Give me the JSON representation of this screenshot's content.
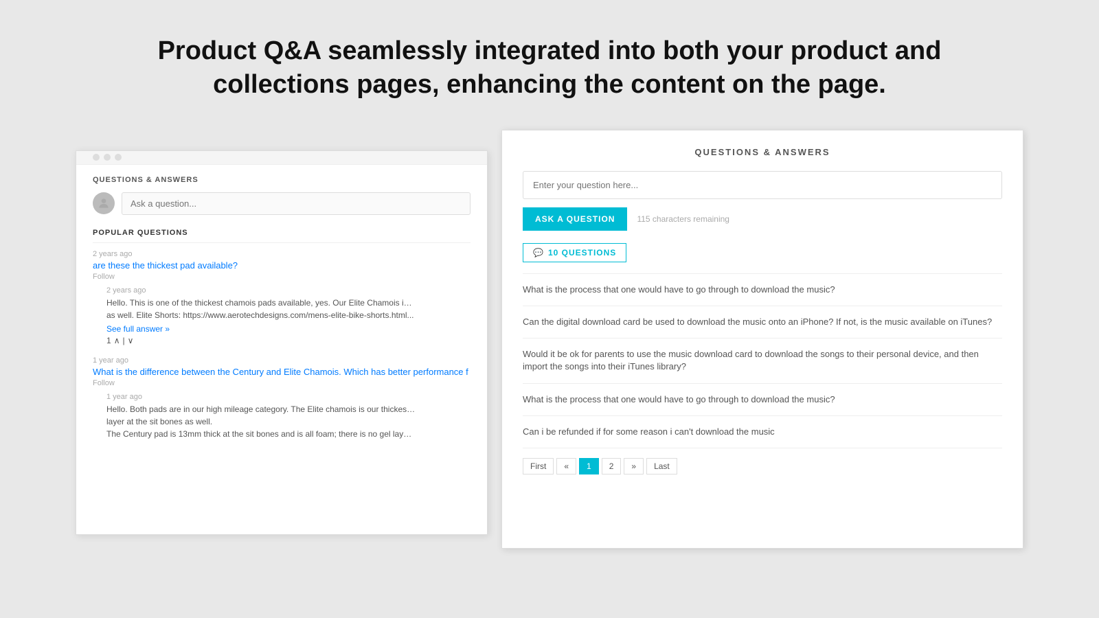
{
  "headline": {
    "line1": "Product Q&A seamlessly integrated into both your  product and",
    "line2": "collections pages, enhancing the content on the page."
  },
  "left_panel": {
    "section_title": "QUESTIONS & ANSWERS",
    "ask_placeholder": "Ask a question...",
    "popular_title": "POPULAR QUESTIONS",
    "questions": [
      {
        "meta": "2 years ago",
        "text": "are these the thickest pad available?",
        "follow": "Follow",
        "answer": {
          "meta": "2 years ago",
          "text": "Hello. This is one of the thickest chamois pads available, yes. Our Elite Chamois is a little b",
          "text2": "as well. Elite Shorts: https://www.aerotechdesigns.com/mens-elite-bike-shorts.html...",
          "see_full": "See full answer »",
          "votes": "1"
        }
      },
      {
        "meta": "1 year ago",
        "text": "What is the difference between the Century and Elite Chamois. Which has better performance f",
        "follow": "Follow",
        "answer": {
          "meta": "1 year ago",
          "text": "Hello. Both pads are in our high mileage category. The Elite chamois is our thickest pad in",
          "text2": "layer at the sit bones as well.",
          "see_full": "",
          "text3": "The Century pad is 13mm thick at the sit bones and is all foam; there is no gel layer like in"
        }
      }
    ]
  },
  "right_panel": {
    "title": "QUESTIONS & ANSWERS",
    "question_placeholder": "Enter your question here...",
    "ask_btn_label": "ASK A QUESTION",
    "chars_remaining": "115 characters remaining",
    "questions_tab_label": "10 QUESTIONS",
    "questions": [
      "What is the process that one would have to go through to download the music?",
      "Can the digital download card be used to download the music onto an iPhone? If not, is the music available on iTunes?",
      "Would it be ok for parents to use the music download card to download the songs to their personal device, and then import the songs into their iTunes library?",
      "What is the process that one would have to go through to download the music?",
      "Can i be refunded if for some reason i can't download the music"
    ],
    "pagination": {
      "first": "First",
      "prev": "«",
      "page1": "1",
      "page2": "2",
      "next": "»",
      "last": "Last"
    }
  }
}
